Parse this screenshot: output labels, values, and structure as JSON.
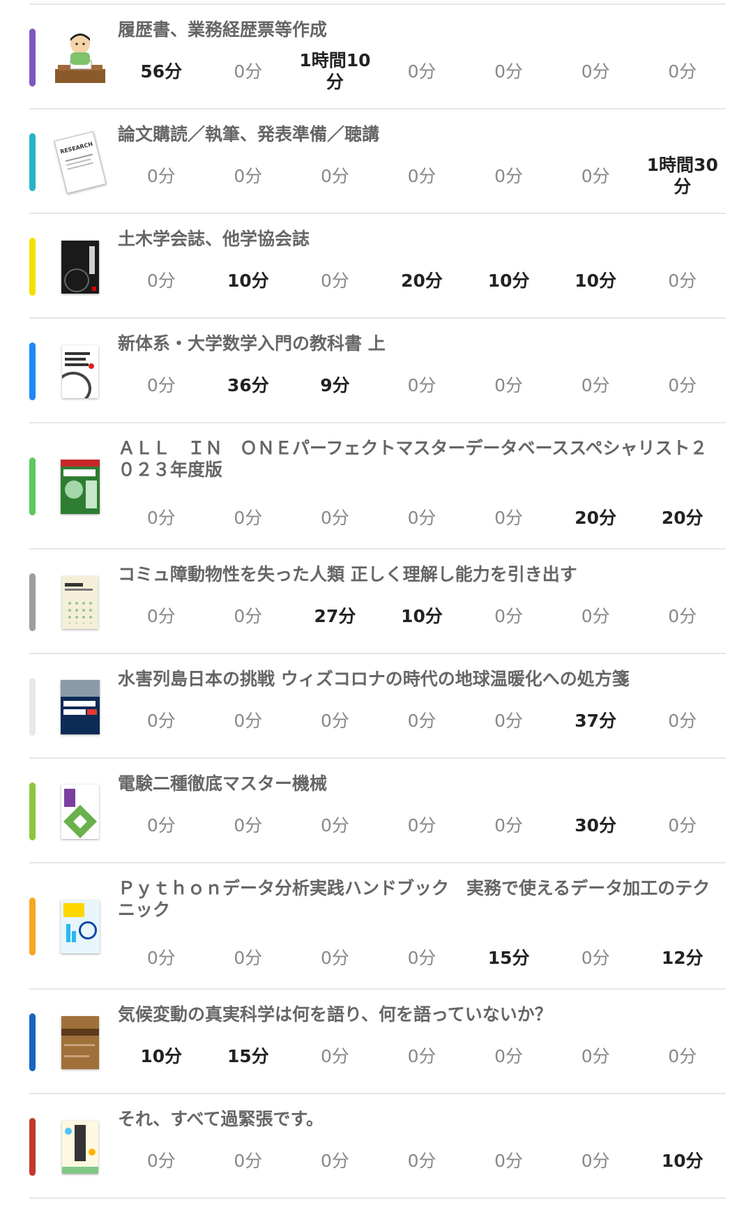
{
  "colors": {
    "divider": "#e6e6e6",
    "active_time": "#222222",
    "zero_time": "#888888",
    "title": "#666666"
  },
  "items": [
    {
      "title": "履歴書、業務経歴票等作成",
      "color": "#7e57c2",
      "icon": "person-writing-icon",
      "times": [
        "56分",
        "0分",
        "1時間10\n分",
        "0分",
        "0分",
        "0分",
        "0分"
      ],
      "active": [
        true,
        false,
        true,
        false,
        false,
        false,
        false
      ]
    },
    {
      "title": "論文購読／執筆、発表準備／聴講",
      "color": "#26b3c8",
      "icon": "research-paper-icon",
      "cover_text": "RESEARCH",
      "times": [
        "0分",
        "0分",
        "0分",
        "0分",
        "0分",
        "0分",
        "1時間30\n分"
      ],
      "active": [
        false,
        false,
        false,
        false,
        false,
        false,
        true
      ]
    },
    {
      "title": "土木学会誌、他学協会誌",
      "color": "#f2e000",
      "icon": "journal-cover-icon",
      "times": [
        "0分",
        "10分",
        "0分",
        "20分",
        "10分",
        "10分",
        "0分"
      ],
      "active": [
        false,
        true,
        false,
        true,
        true,
        true,
        false
      ]
    },
    {
      "title": "新体系・大学数学入門の教科書 上",
      "color": "#1e88f5",
      "icon": "math-book-cover-icon",
      "times": [
        "0分",
        "36分",
        "9分",
        "0分",
        "0分",
        "0分",
        "0分"
      ],
      "active": [
        false,
        true,
        true,
        false,
        false,
        false,
        false
      ]
    },
    {
      "title": "ＡＬＬ　ＩＮ　ＯＮＥパーフェクトマスターデータベーススペシャリスト２０２３年度版",
      "color": "#5bc85b",
      "icon": "database-book-cover-icon",
      "times": [
        "0分",
        "0分",
        "0分",
        "0分",
        "0分",
        "20分",
        "20分"
      ],
      "active": [
        false,
        false,
        false,
        false,
        false,
        true,
        true
      ]
    },
    {
      "title": "コミュ障動物性を失った人類 正しく理解し能力を引き出す",
      "color": "#9e9e9e",
      "icon": "communication-book-cover-icon",
      "times": [
        "0分",
        "0分",
        "27分",
        "10分",
        "0分",
        "0分",
        "0分"
      ],
      "active": [
        false,
        false,
        true,
        true,
        false,
        false,
        false
      ]
    },
    {
      "title": "水害列島日本の挑戦 ウィズコロナの時代の地球温暖化への処方箋",
      "color": "#e8e8e8",
      "icon": "flood-book-cover-icon",
      "times": [
        "0分",
        "0分",
        "0分",
        "0分",
        "0分",
        "37分",
        "0分"
      ],
      "active": [
        false,
        false,
        false,
        false,
        false,
        true,
        false
      ]
    },
    {
      "title": "電験二種徹底マスター機械",
      "color": "#8cc63f",
      "icon": "machine-book-cover-icon",
      "times": [
        "0分",
        "0分",
        "0分",
        "0分",
        "0分",
        "30分",
        "0分"
      ],
      "active": [
        false,
        false,
        false,
        false,
        false,
        true,
        false
      ]
    },
    {
      "title": "Ｐｙｔｈｏｎデータ分析実践ハンドブック　実務で使えるデータ加工のテクニック",
      "color": "#f5a623",
      "icon": "python-book-cover-icon",
      "times": [
        "0分",
        "0分",
        "0分",
        "0分",
        "15分",
        "0分",
        "12分"
      ],
      "active": [
        false,
        false,
        false,
        false,
        true,
        false,
        true
      ]
    },
    {
      "title": "気候変動の真実科学は何を語り、何を語っていないか？",
      "color": "#1565c0",
      "icon": "climate-book-cover-icon",
      "times": [
        "10分",
        "15分",
        "0分",
        "0分",
        "0分",
        "0分",
        "0分"
      ],
      "active": [
        true,
        true,
        false,
        false,
        false,
        false,
        false
      ]
    },
    {
      "title": "それ、すべて過緊張です。",
      "color": "#c0392b",
      "icon": "tension-book-cover-icon",
      "times": [
        "0分",
        "0分",
        "0分",
        "0分",
        "0分",
        "0分",
        "10分"
      ],
      "active": [
        false,
        false,
        false,
        false,
        false,
        false,
        true
      ]
    }
  ]
}
